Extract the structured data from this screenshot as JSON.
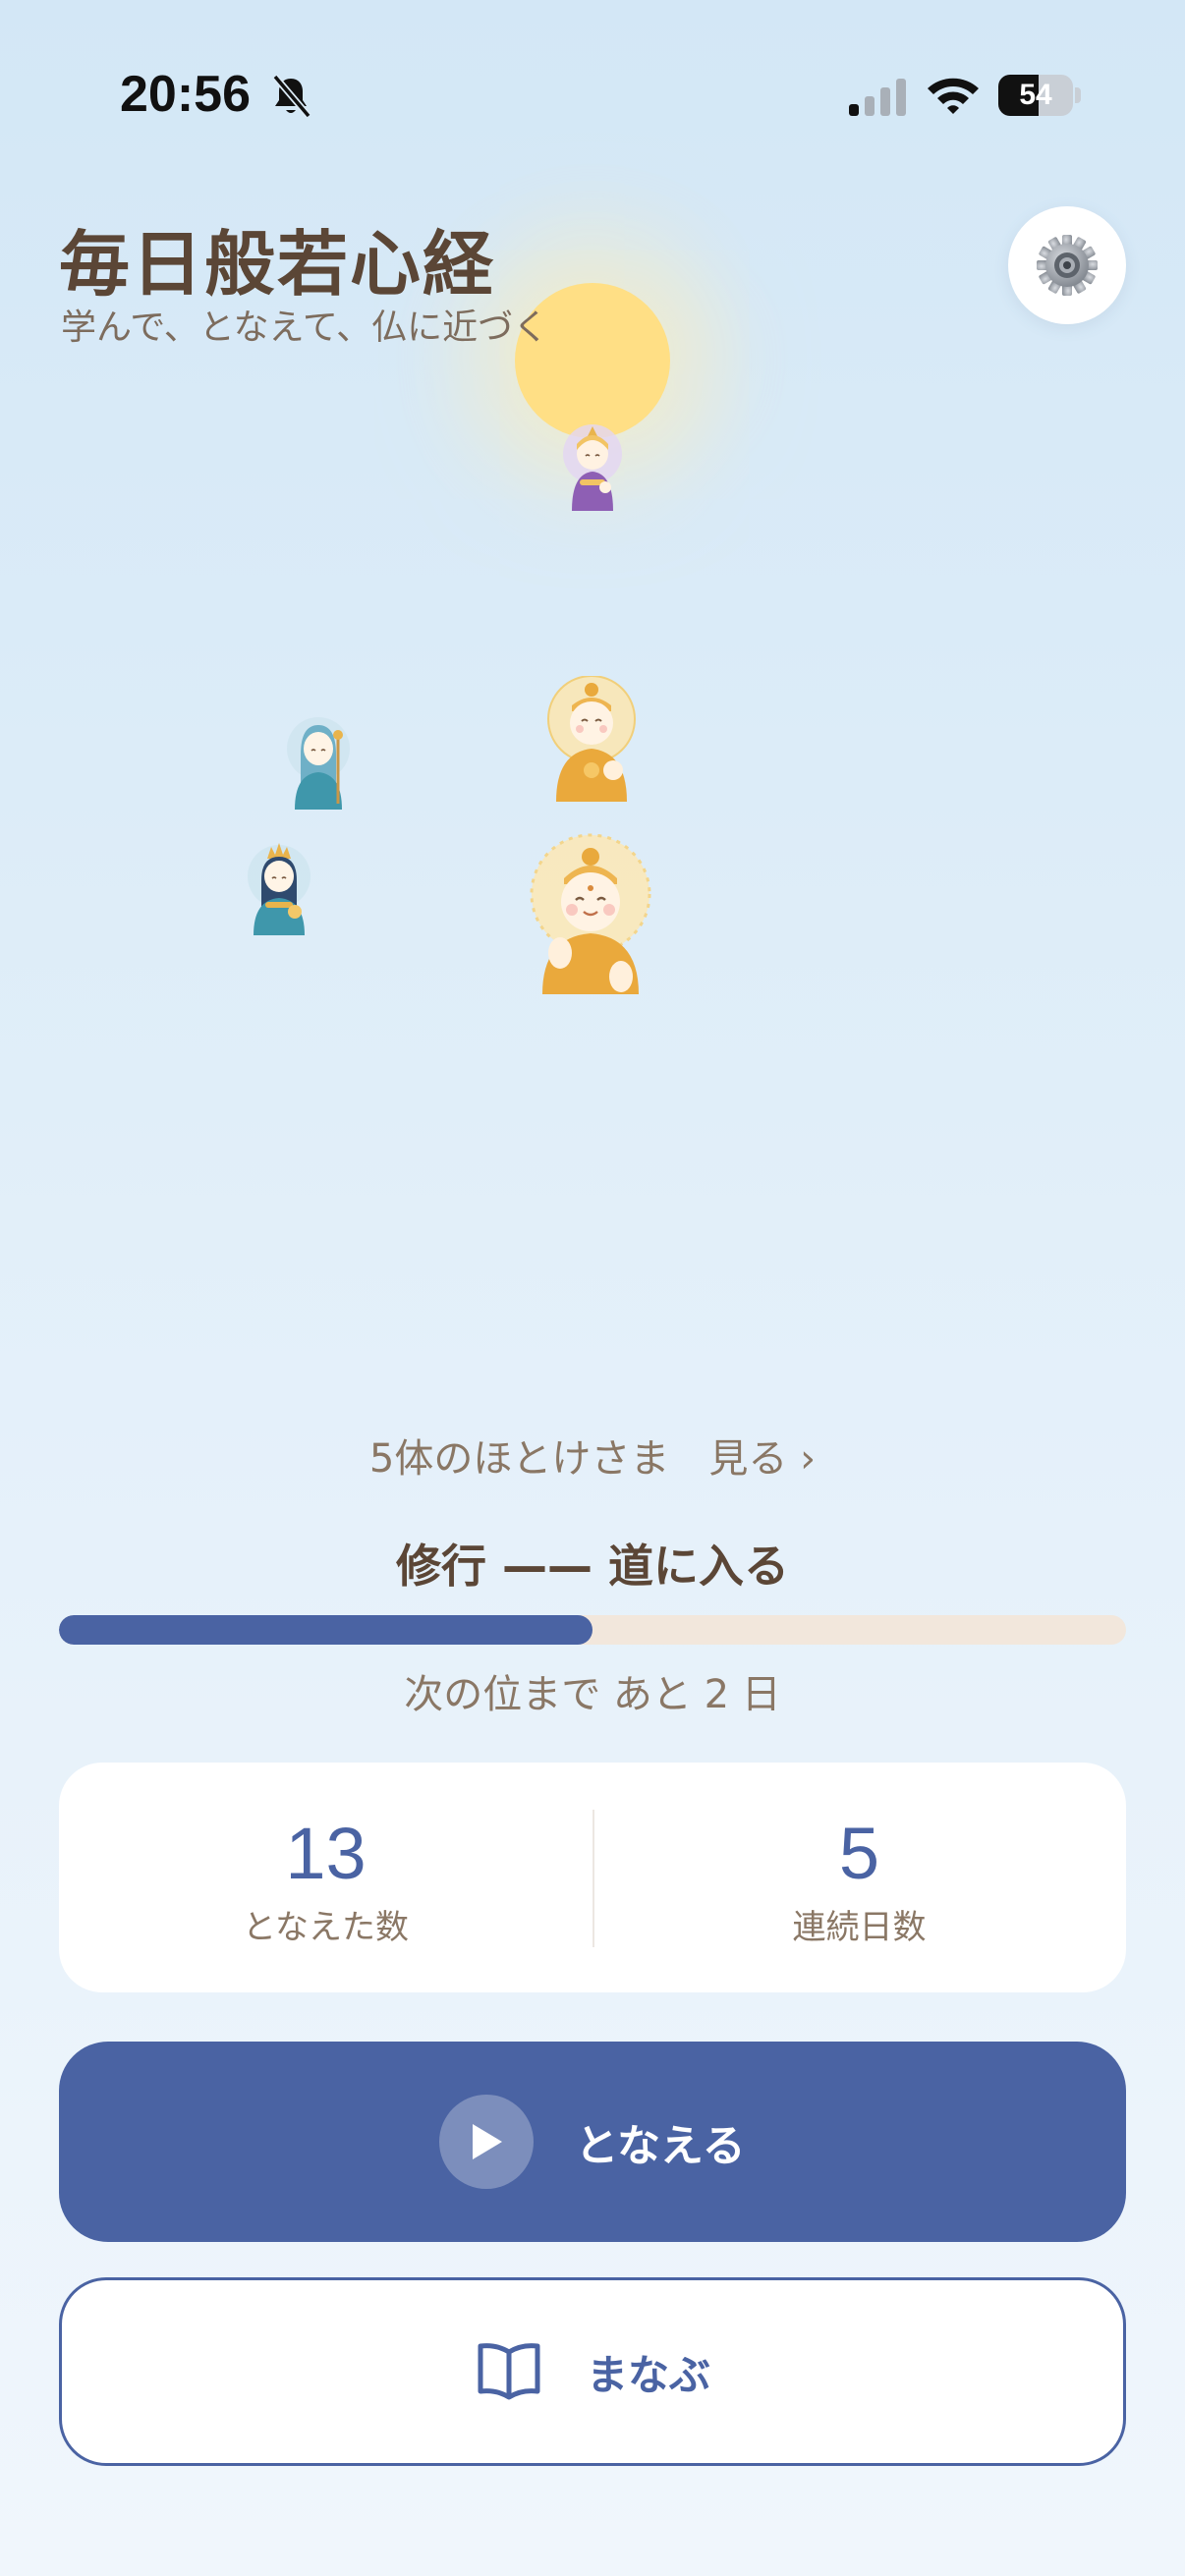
{
  "status_bar": {
    "time": "20:56",
    "battery_level": "54",
    "battery_fraction": 0.54,
    "icons": [
      "bell-slash-icon",
      "cellular-signal-icon",
      "wifi-icon",
      "battery-icon"
    ]
  },
  "header": {
    "title": "毎日般若心経",
    "subtitle": "学んで、となえて、仏に近づく",
    "settings_icon": "gear-icon"
  },
  "scene": {
    "figures": [
      "buddha-purple",
      "buddha-teal-small",
      "buddha-teal-crowned",
      "buddha-gold",
      "buddha-gold-large"
    ]
  },
  "buddhas_link": "5体のほとけさま　見る ›",
  "rank": {
    "title": "修行 —— 道に入る",
    "progress": 0.5,
    "next_text": "次の位まで あと 2 日"
  },
  "stats": {
    "chant_count": "13",
    "chant_count_label": "となえた数",
    "streak_days": "5",
    "streak_days_label": "連続日数"
  },
  "actions": {
    "chant_label": "となえる",
    "chant_icon": "play-icon",
    "learn_label": "まなぶ",
    "learn_icon": "book-icon"
  },
  "colors": {
    "accent": "#4a63a3",
    "title_brown": "#5b4636",
    "text_brown": "#8a7765",
    "progress_track": "#f2e7dc",
    "sun": "#ffdf85"
  }
}
